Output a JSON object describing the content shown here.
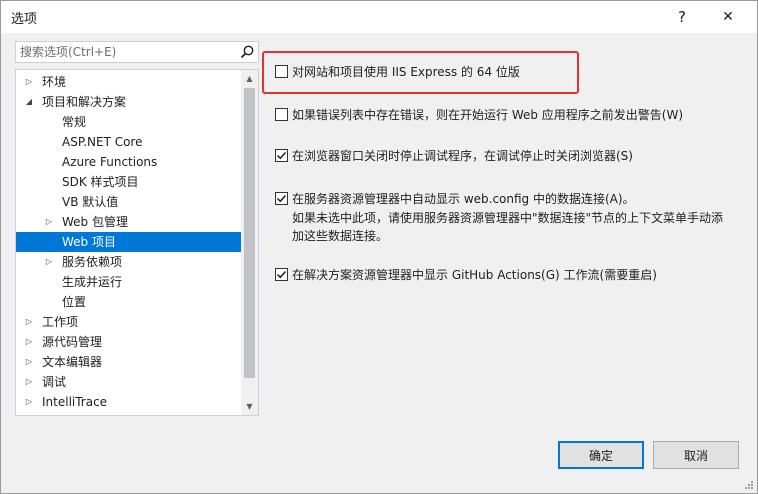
{
  "window": {
    "title": "选项",
    "help_label": "?",
    "close_label": "✕"
  },
  "search": {
    "placeholder": "搜索选项(Ctrl+E)"
  },
  "tree": {
    "items": [
      {
        "label": "环境",
        "arrow": "▷",
        "level": 0
      },
      {
        "label": "项目和解决方案",
        "arrow": "◢",
        "level": 0
      },
      {
        "label": "常规",
        "arrow": "",
        "level": 1
      },
      {
        "label": "ASP.NET Core",
        "arrow": "",
        "level": 1
      },
      {
        "label": "Azure Functions",
        "arrow": "",
        "level": 1
      },
      {
        "label": "SDK 样式项目",
        "arrow": "",
        "level": 1
      },
      {
        "label": "VB 默认值",
        "arrow": "",
        "level": 1
      },
      {
        "label": "Web 包管理",
        "arrow": "▷",
        "level": 1
      },
      {
        "label": "Web 项目",
        "arrow": "",
        "level": 1,
        "selected": true
      },
      {
        "label": "服务依赖项",
        "arrow": "▷",
        "level": 1
      },
      {
        "label": "生成并运行",
        "arrow": "",
        "level": 1
      },
      {
        "label": "位置",
        "arrow": "",
        "level": 1
      },
      {
        "label": "工作项",
        "arrow": "▷",
        "level": 0
      },
      {
        "label": "源代码管理",
        "arrow": "▷",
        "level": 0
      },
      {
        "label": "文本编辑器",
        "arrow": "▷",
        "level": 0
      },
      {
        "label": "调试",
        "arrow": "▷",
        "level": 0
      },
      {
        "label": "IntelliTrace",
        "arrow": "▷",
        "level": 0
      }
    ],
    "scroll_up": "▲",
    "scroll_down": "▼"
  },
  "options": [
    {
      "label": "对网站和项目使用 IIS Express 的 64 位版",
      "checked": false
    },
    {
      "label": "如果错误列表中存在错误，则在开始运行 Web 应用程序之前发出警告(W)",
      "checked": false
    },
    {
      "label": "在浏览器窗口关闭时停止调试程序，在调试停止时关闭浏览器(S)",
      "checked": true
    },
    {
      "label": "在服务器资源管理器中自动显示 web.config 中的数据连接(A)。",
      "checked": true,
      "description": "如果未选中此项，请使用服务器资源管理器中\"数据连接\"节点的上下文菜单手动添加这些数据连接。"
    },
    {
      "label": "在解决方案资源管理器中显示 GitHub Actions(G) 工作流(需要重启)",
      "checked": true
    }
  ],
  "buttons": {
    "ok": "确定",
    "cancel": "取消"
  },
  "colors": {
    "selection": "#0078d7",
    "highlight_border": "#e8312f"
  }
}
